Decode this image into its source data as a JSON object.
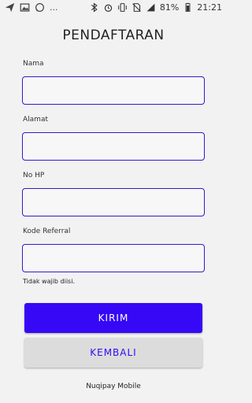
{
  "status_bar": {
    "overflow": "...",
    "battery": "81%",
    "time": "21:21",
    "icons": [
      "send-icon",
      "image-icon",
      "whatsapp-icon",
      "bluetooth-icon",
      "alarm-icon",
      "vibrate-icon",
      "no-sim-icon",
      "signal-icon",
      "battery-icon"
    ]
  },
  "form": {
    "title": "PENDAFTARAN",
    "fields": [
      {
        "label": "Nama",
        "value": "",
        "placeholder": ""
      },
      {
        "label": "Alamat",
        "value": "",
        "placeholder": ""
      },
      {
        "label": "No HP",
        "value": "",
        "placeholder": ""
      },
      {
        "label": "Kode Referral",
        "value": "",
        "placeholder": ""
      }
    ],
    "referral_hint": "Tidak wajib diisi."
  },
  "actions": {
    "submit_label": "KIRIM",
    "back_label": "KEMBALI"
  },
  "footer": {
    "app_name": "Nuqipay Mobile"
  },
  "colors": {
    "accent": "#3608f5",
    "field_border": "#3a17c8",
    "background": "#f2f2f2",
    "secondary_button": "#dcdcdc"
  }
}
